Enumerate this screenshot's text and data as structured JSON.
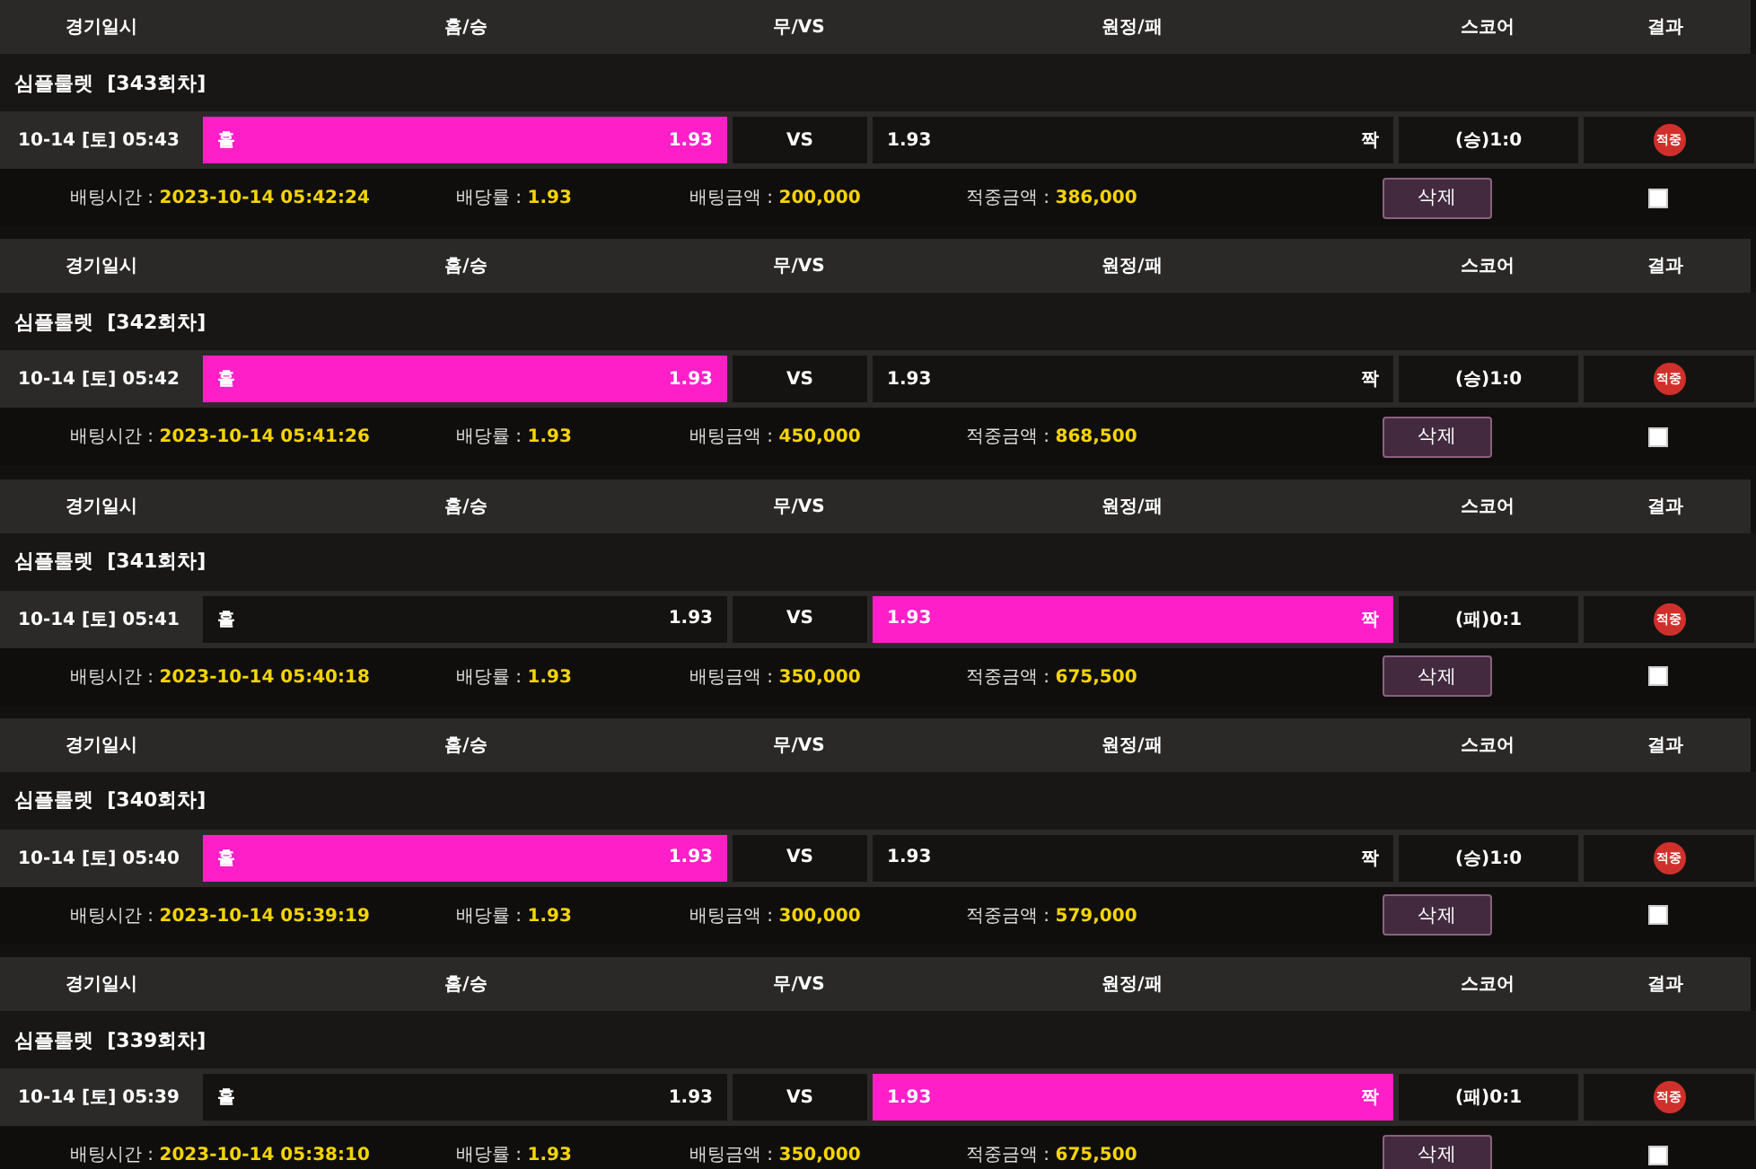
{
  "bets": [
    {
      "columns": [
        "경기일시",
        "홈/승",
        "무/VS",
        "원정/패",
        "스코어",
        "결과"
      ],
      "round": "심플룰렛  [343회차]",
      "date": "10-14 [토] 05:43",
      "home": {
        "label": "홀",
        "odds": "1.93",
        "selected": true
      },
      "vs": "VS",
      "away": {
        "odds": "1.93",
        "label": "짝",
        "selected": false
      },
      "score": "(승)1:0",
      "result": "적중",
      "bet_time_label": "배팅시간 :",
      "bet_time": "2023-10-14 05:42:24",
      "rate_label": "배당률 :",
      "rate": "1.93",
      "amount_label": "배팅금액 :",
      "amount": "200,000",
      "win_label": "적중금액 :",
      "win": "386,000",
      "delete": "삭제",
      "checked": false
    },
    {
      "columns": [
        "경기일시",
        "홈/승",
        "무/VS",
        "원정/패",
        "스코어",
        "결과"
      ],
      "round": "심플룰렛  [342회차]",
      "date": "10-14 [토] 05:42",
      "home": {
        "label": "홀",
        "odds": "1.93",
        "selected": true
      },
      "vs": "VS",
      "away": {
        "odds": "1.93",
        "label": "짝",
        "selected": false
      },
      "score": "(승)1:0",
      "result": "적중",
      "bet_time_label": "배팅시간 :",
      "bet_time": "2023-10-14 05:41:26",
      "rate_label": "배당률 :",
      "rate": "1.93",
      "amount_label": "배팅금액 :",
      "amount": "450,000",
      "win_label": "적중금액 :",
      "win": "868,500",
      "delete": "삭제",
      "checked": false
    },
    {
      "columns": [
        "경기일시",
        "홈/승",
        "무/VS",
        "원정/패",
        "스코어",
        "결과"
      ],
      "round": "심플룰렛  [341회차]",
      "date": "10-14 [토] 05:41",
      "home": {
        "label": "홀",
        "odds": "1.93",
        "selected": false
      },
      "vs": "VS",
      "away": {
        "odds": "1.93",
        "label": "짝",
        "selected": true
      },
      "score": "(패)0:1",
      "result": "적중",
      "bet_time_label": "배팅시간 :",
      "bet_time": "2023-10-14 05:40:18",
      "rate_label": "배당률 :",
      "rate": "1.93",
      "amount_label": "배팅금액 :",
      "amount": "350,000",
      "win_label": "적중금액 :",
      "win": "675,500",
      "delete": "삭제",
      "checked": false
    },
    {
      "columns": [
        "경기일시",
        "홈/승",
        "무/VS",
        "원정/패",
        "스코어",
        "결과"
      ],
      "round": "심플룰렛  [340회차]",
      "date": "10-14 [토] 05:40",
      "home": {
        "label": "홀",
        "odds": "1.93",
        "selected": true
      },
      "vs": "VS",
      "away": {
        "odds": "1.93",
        "label": "짝",
        "selected": false
      },
      "score": "(승)1:0",
      "result": "적중",
      "bet_time_label": "배팅시간 :",
      "bet_time": "2023-10-14 05:39:19",
      "rate_label": "배당률 :",
      "rate": "1.93",
      "amount_label": "배팅금액 :",
      "amount": "300,000",
      "win_label": "적중금액 :",
      "win": "579,000",
      "delete": "삭제",
      "checked": false
    },
    {
      "columns": [
        "경기일시",
        "홈/승",
        "무/VS",
        "원정/패",
        "스코어",
        "결과"
      ],
      "round": "심플룰렛  [339회차]",
      "date": "10-14 [토] 05:39",
      "home": {
        "label": "홀",
        "odds": "1.93",
        "selected": false
      },
      "vs": "VS",
      "away": {
        "odds": "1.93",
        "label": "짝",
        "selected": true
      },
      "score": "(패)0:1",
      "result": "적중",
      "bet_time_label": "배팅시간 :",
      "bet_time": "2023-10-14 05:38:10",
      "rate_label": "배당률 :",
      "rate": "1.93",
      "amount_label": "배팅금액 :",
      "amount": "350,000",
      "win_label": "적중금액 :",
      "win": "675,500",
      "delete": "삭제",
      "checked": false
    }
  ]
}
